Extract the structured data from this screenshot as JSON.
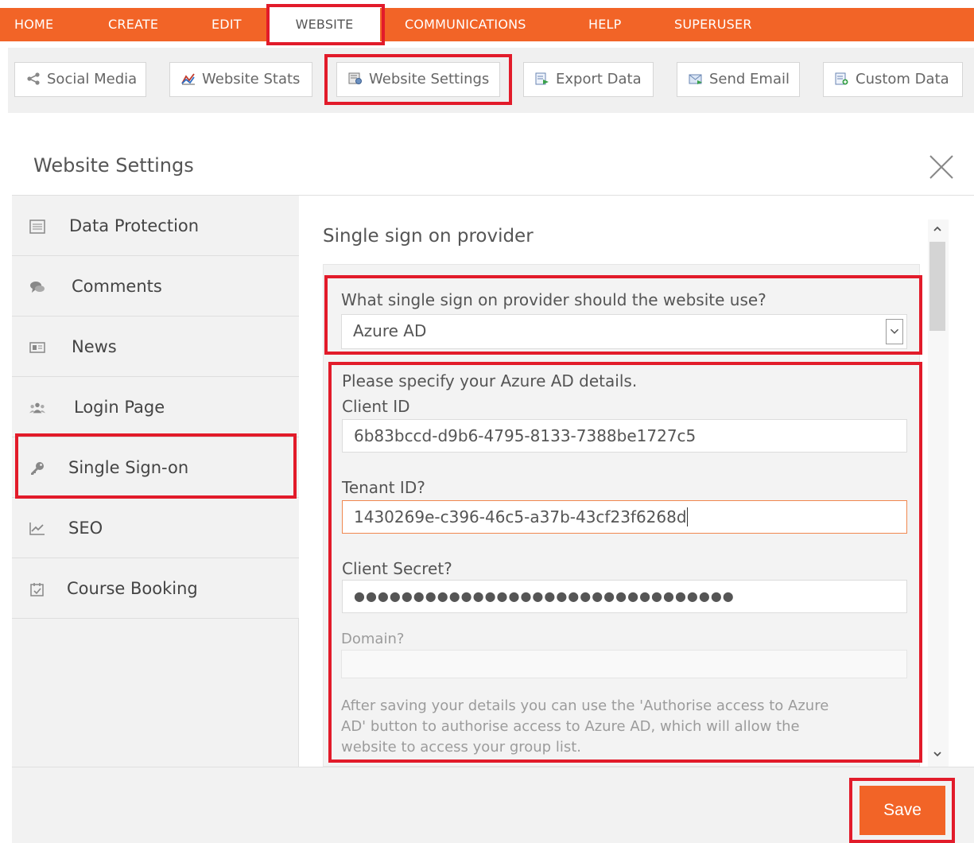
{
  "nav": {
    "items": [
      "HOME",
      "CREATE",
      "EDIT",
      "WEBSITE",
      "COMMUNICATIONS",
      "HELP",
      "SUPERUSER"
    ]
  },
  "toolbar": {
    "buttons": [
      "Social Media",
      "Website Stats",
      "Website Settings",
      "Export Data",
      "Send Email",
      "Custom Data"
    ]
  },
  "dialog": {
    "title": "Website Settings"
  },
  "sidebar": {
    "items": [
      "Data Protection",
      "Comments",
      "News",
      "Login Page",
      "Single Sign-on",
      "SEO",
      "Course Booking"
    ]
  },
  "content": {
    "section_title": "Single sign on provider",
    "provider_question": "What single sign on provider should the website use?",
    "provider_value": "Azure AD",
    "details_intro": "Please specify your Azure AD details.",
    "client_id_label": "Client ID",
    "client_id_value": "6b83bccd-d9b6-4795-8133-7388be1727c5",
    "tenant_id_label": "Tenant ID?",
    "tenant_id_value": "1430269e-c396-46c5-a37b-43cf23f6268d",
    "client_secret_label": "Client Secret?",
    "client_secret_value": "●●●●●●●●●●●●●●●●●●●●●●●●●●●●●●●●",
    "domain_label": "Domain?",
    "domain_value": "",
    "help_text_line1": "After saving your details you can use the 'Authorise access to Azure",
    "help_text_line2": "AD' button to authorise access to Azure AD, which will allow the",
    "help_text_line3": "website to access your group list."
  },
  "footer": {
    "save_label": "Save"
  },
  "colors": {
    "brand_orange": "#f26427",
    "highlight_red": "#e21b2a",
    "focus_orange": "#f0874f"
  }
}
